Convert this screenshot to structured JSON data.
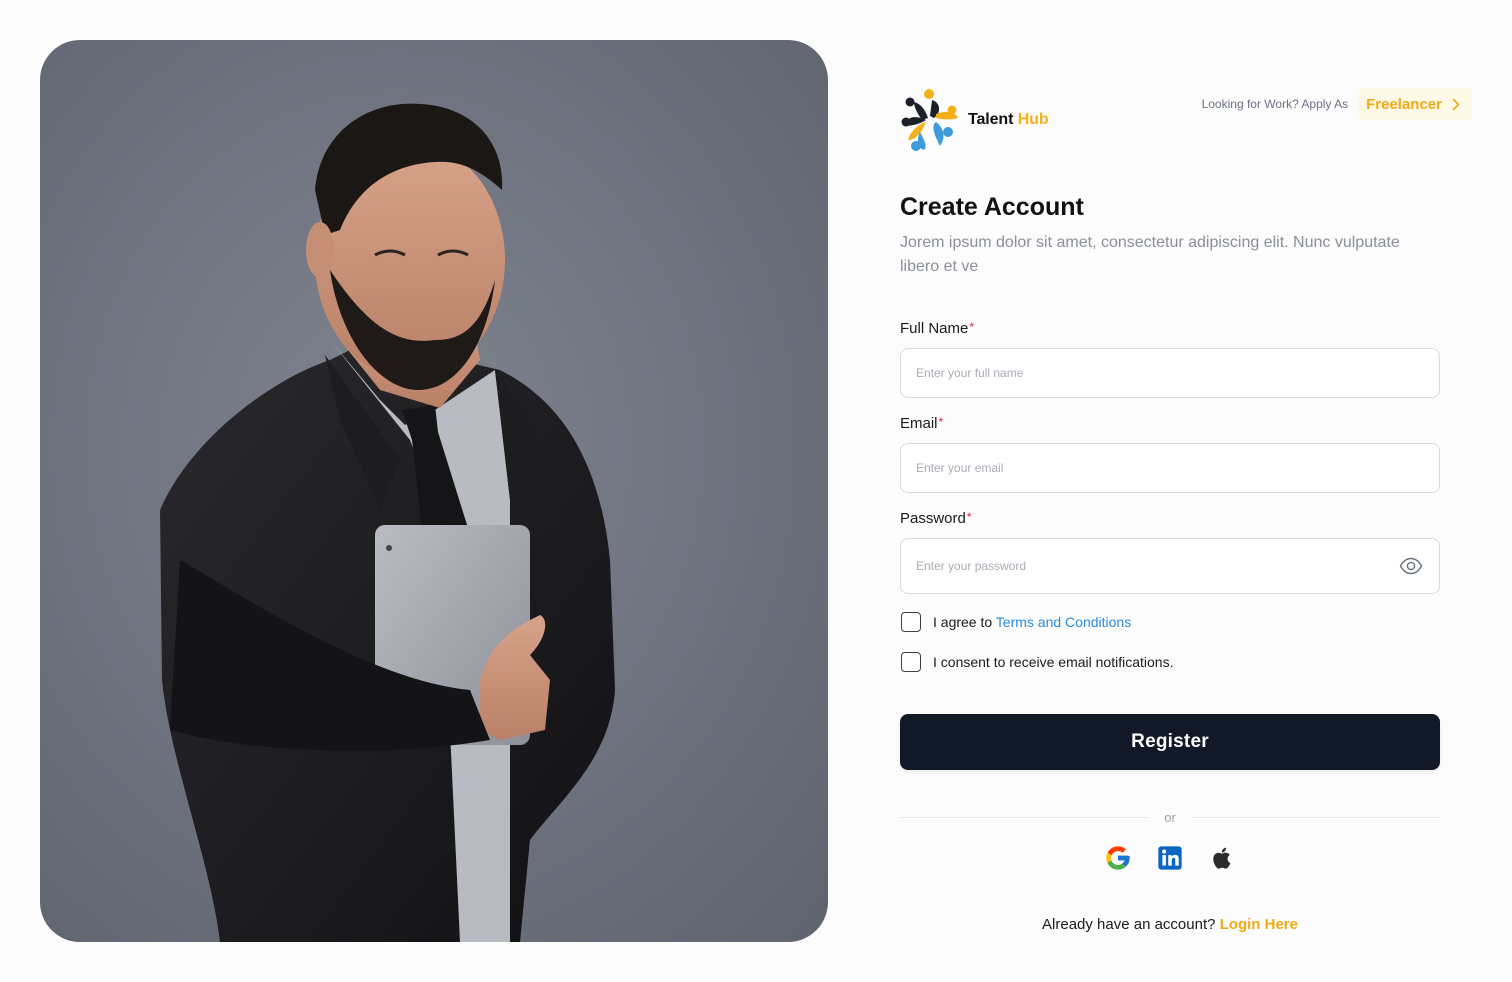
{
  "brand": {
    "name_part1": "Talent ",
    "name_part2": "Hub",
    "accent_color": "#f4b01b"
  },
  "header": {
    "apply_text": "Looking for Work? Apply As",
    "freelancer_label": "Freelancer"
  },
  "form": {
    "title": "Create Account",
    "subtitle": "Jorem ipsum dolor sit amet, consectetur adipiscing elit. Nunc vulputate libero et ve",
    "full_name": {
      "label": "Full Name",
      "required_mark": "*",
      "placeholder": "Enter your full name",
      "value": ""
    },
    "email": {
      "label": "Email",
      "required_mark": "*",
      "placeholder": "Enter your email",
      "value": ""
    },
    "password": {
      "label": "Password",
      "required_mark": "*",
      "placeholder": "Enter your password",
      "value": "",
      "toggle_icon": "eye-icon"
    },
    "agree_prefix": "I agree to ",
    "terms_link": "Terms and Conditions",
    "consent_text": "I consent to receive email notifications.",
    "register_label": "Register",
    "or_text": "or",
    "social_icons": [
      "google-icon",
      "linkedin-icon",
      "apple-icon"
    ],
    "login_prefix": "Already have an account? ",
    "login_link": "Login Here"
  },
  "colors": {
    "primary_button": "#111827",
    "accent": "#f0aa14",
    "link": "#2a8bd8",
    "required": "#e11d48"
  }
}
